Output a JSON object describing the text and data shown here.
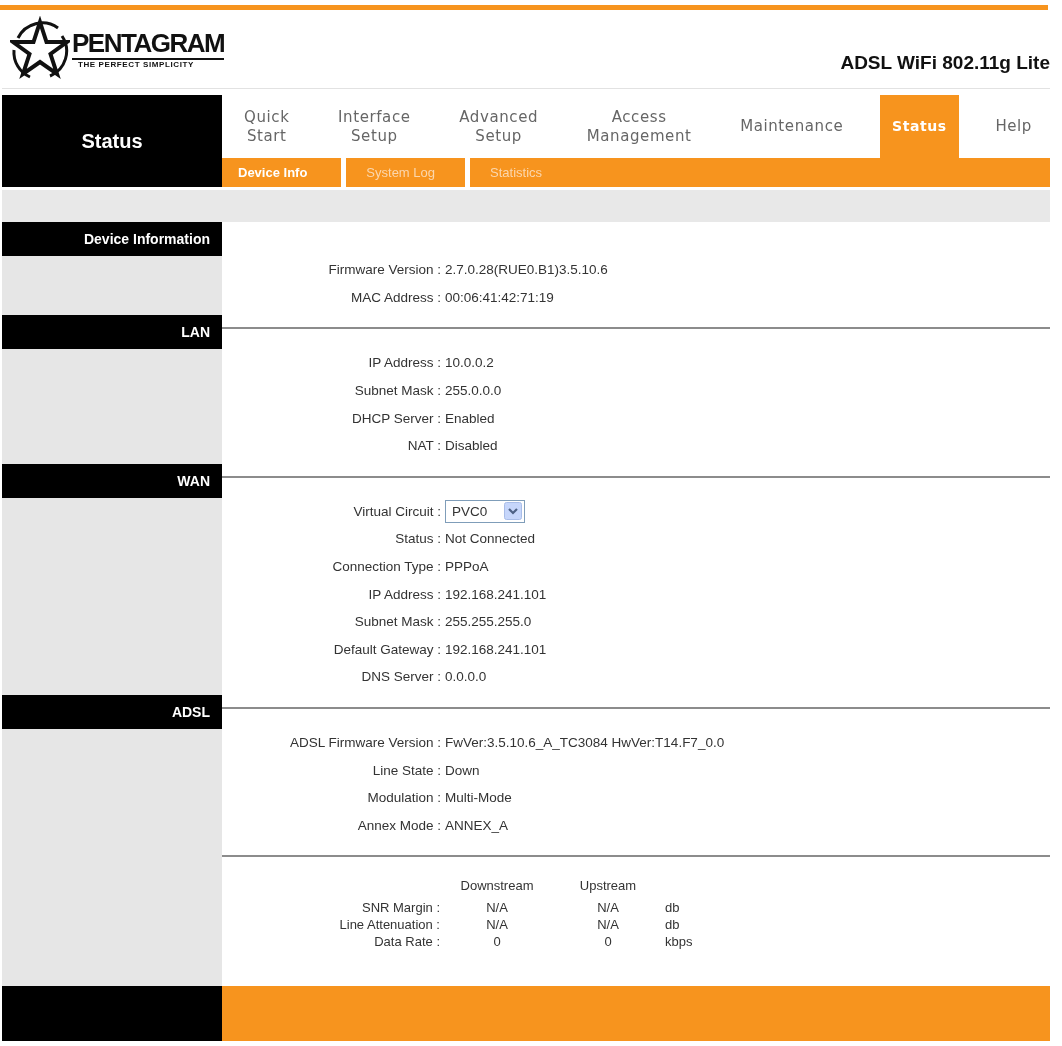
{
  "header": {
    "brand": "PENTAGRAM",
    "tagline": "THE PERFECT SIMPLICITY",
    "product": "ADSL WiFi 802.11g Lite"
  },
  "nav": {
    "current_section": "Status",
    "tabs": [
      {
        "label": "Quick Start",
        "selected": false
      },
      {
        "label": "Interface Setup",
        "selected": false
      },
      {
        "label": "Advanced Setup",
        "selected": false
      },
      {
        "label": "Access Management",
        "selected": false
      },
      {
        "label": "Maintenance",
        "selected": false
      },
      {
        "label": "Status",
        "selected": true
      },
      {
        "label": "Help",
        "selected": false
      }
    ],
    "subtabs": [
      {
        "label": "Device Info",
        "selected": true
      },
      {
        "label": "System Log",
        "selected": false
      },
      {
        "label": "Statistics",
        "selected": false
      }
    ]
  },
  "sections": [
    {
      "title": "Device Information",
      "fields": [
        {
          "kind": "text",
          "label": "Firmware Version :",
          "value": "2.7.0.28(RUE0.B1)3.5.10.6"
        },
        {
          "kind": "text",
          "label": "MAC Address :",
          "value": "00:06:41:42:71:19"
        }
      ]
    },
    {
      "title": "LAN",
      "fields": [
        {
          "kind": "text",
          "label": "IP Address :",
          "value": "10.0.0.2"
        },
        {
          "kind": "text",
          "label": "Subnet Mask :",
          "value": "255.0.0.0"
        },
        {
          "kind": "text",
          "label": "DHCP Server :",
          "value": "Enabled"
        },
        {
          "kind": "text",
          "label": "NAT :",
          "value": "Disabled"
        }
      ]
    },
    {
      "title": "WAN",
      "fields": [
        {
          "kind": "select",
          "label": "Virtual Circuit :",
          "value": "PVC0"
        },
        {
          "kind": "text",
          "label": "Status :",
          "value": "Not Connected"
        },
        {
          "kind": "text",
          "label": "Connection Type :",
          "value": "PPPoA"
        },
        {
          "kind": "text",
          "label": "IP Address :",
          "value": "192.168.241.101"
        },
        {
          "kind": "text",
          "label": "Subnet Mask :",
          "value": "255.255.255.0"
        },
        {
          "kind": "text",
          "label": "Default Gateway :",
          "value": "192.168.241.101"
        },
        {
          "kind": "text",
          "label": "DNS Server :",
          "value": "0.0.0.0"
        }
      ]
    },
    {
      "title": "ADSL",
      "fields": [
        {
          "kind": "text",
          "label": "ADSL Firmware Version :",
          "value": "FwVer:3.5.10.6_A_TC3084 HwVer:T14.F7_0.0"
        },
        {
          "kind": "text",
          "label": "Line State :",
          "value": "Down"
        },
        {
          "kind": "text",
          "label": "Modulation :",
          "value": "Multi-Mode"
        },
        {
          "kind": "text",
          "label": "Annex Mode :",
          "value": "ANNEX_A"
        }
      ]
    }
  ],
  "line_stats": {
    "columns": [
      "Downstream",
      "Upstream"
    ],
    "rows": [
      {
        "label": "SNR Margin :",
        "downstream": "N/A",
        "upstream": "N/A",
        "unit": "db"
      },
      {
        "label": "Line Attenuation :",
        "downstream": "N/A",
        "upstream": "N/A",
        "unit": "db"
      },
      {
        "label": "Data Rate :",
        "downstream": "0",
        "upstream": "0",
        "unit": "kbps"
      }
    ]
  }
}
